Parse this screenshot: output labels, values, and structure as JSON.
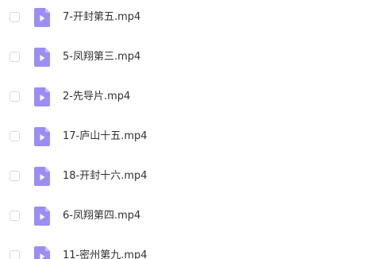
{
  "files": [
    {
      "name": "7-开封第五.mp4",
      "icon": "video-file-icon",
      "checked": false
    },
    {
      "name": "5-凤翔第三.mp4",
      "icon": "video-file-icon",
      "checked": false
    },
    {
      "name": "2-先导片.mp4",
      "icon": "video-file-icon",
      "checked": false
    },
    {
      "name": "17-庐山十五.mp4",
      "icon": "video-file-icon",
      "checked": false
    },
    {
      "name": "18-开封十六.mp4",
      "icon": "video-file-icon",
      "checked": false
    },
    {
      "name": "6-凤翔第四.mp4",
      "icon": "video-file-icon",
      "checked": false
    },
    {
      "name": "11-密州第九.mp4",
      "icon": "video-file-icon",
      "checked": false
    }
  ],
  "colors": {
    "icon_body": "#9a8ef5",
    "icon_fold": "#c6bdfb",
    "icon_play": "#ffffff",
    "text": "#303133",
    "checkbox_border": "#d9d9de"
  }
}
